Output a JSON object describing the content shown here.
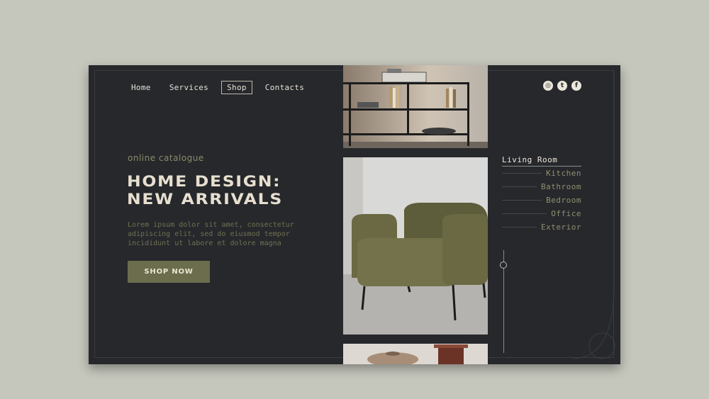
{
  "nav": {
    "items": [
      {
        "label": "Home"
      },
      {
        "label": "Services"
      },
      {
        "label": "Shop"
      },
      {
        "label": "Contacts"
      }
    ],
    "active": "Shop"
  },
  "hero": {
    "subtitle": "online catalogue",
    "title_line1": "HOME DESIGN:",
    "title_line2": "NEW ARRIVALS",
    "lorem_line1": "Lorem ipsum dolor sit amet, consectetur",
    "lorem_line2": "adipiscing elit, sed do eiusmod tempor",
    "lorem_line3": "incididunt ut labore et dolore magna",
    "cta": "SHOP NOW"
  },
  "social": [
    {
      "icon": "instagram-icon",
      "glyph": "◎"
    },
    {
      "icon": "twitter-icon",
      "glyph": "t"
    },
    {
      "icon": "facebook-icon",
      "glyph": "f"
    }
  ],
  "rooms": {
    "active": "Living Room",
    "items": [
      "Kitchen",
      "Bathroom",
      "Bedroom",
      "Office",
      "Exterior"
    ]
  },
  "colors": {
    "page_bg": "#c5c6bc",
    "panel_bg": "#27282c",
    "accent_olive": "#6b6d4c",
    "headline": "#e7dfcf"
  }
}
